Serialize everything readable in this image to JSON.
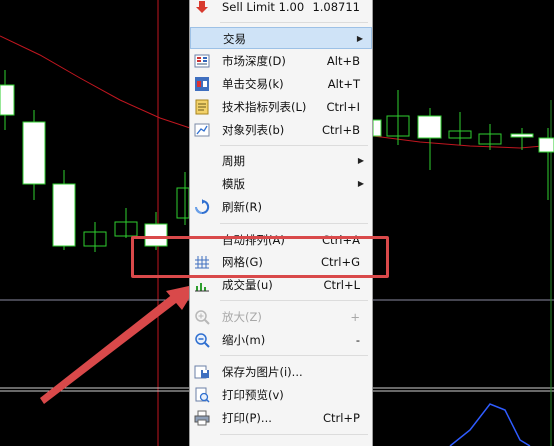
{
  "colors": {
    "accent_highlight": "#cfe3f7",
    "annotation_red": "#d9494a"
  },
  "menu": {
    "items": [
      {
        "icon": "sell-arrow-icon",
        "label": "Sell Limit 1.00",
        "shortcut": "1.08711"
      },
      {
        "label": "交易",
        "submenu": true,
        "highlighted": true
      },
      {
        "icon": "market-depth-icon",
        "label": "市场深度(D)",
        "shortcut": "Alt+B"
      },
      {
        "icon": "one-click-trading-icon",
        "label": "单击交易(k)",
        "shortcut": "Alt+T"
      },
      {
        "icon": "indicator-list-icon",
        "label": "技术指标列表(L)",
        "shortcut": "Ctrl+I"
      },
      {
        "icon": "object-list-icon",
        "label": "对象列表(b)",
        "shortcut": "Ctrl+B"
      },
      {
        "label": "周期",
        "submenu": true
      },
      {
        "label": "模版",
        "submenu": true
      },
      {
        "icon": "refresh-icon",
        "label": "刷新(R)"
      },
      {
        "label": "自动排列(A)",
        "shortcut": "Ctrl+A"
      },
      {
        "icon": "grid-icon",
        "label": "网格(G)",
        "shortcut": "Ctrl+G"
      },
      {
        "icon": "volume-icon",
        "label": "成交量(u)",
        "shortcut": "Ctrl+L"
      },
      {
        "icon": "zoom-in-icon",
        "label": "放大(Z)",
        "shortcut": "+",
        "disabled": true
      },
      {
        "icon": "zoom-out-icon",
        "label": "缩小(m)",
        "shortcut": "-"
      },
      {
        "icon": "save-picture-icon",
        "label": "保存为图片(i)..."
      },
      {
        "icon": "print-preview-icon",
        "label": "打印预览(v)"
      },
      {
        "icon": "print-icon",
        "label": "打印(P)...",
        "shortcut": "Ctrl+P"
      }
    ]
  }
}
